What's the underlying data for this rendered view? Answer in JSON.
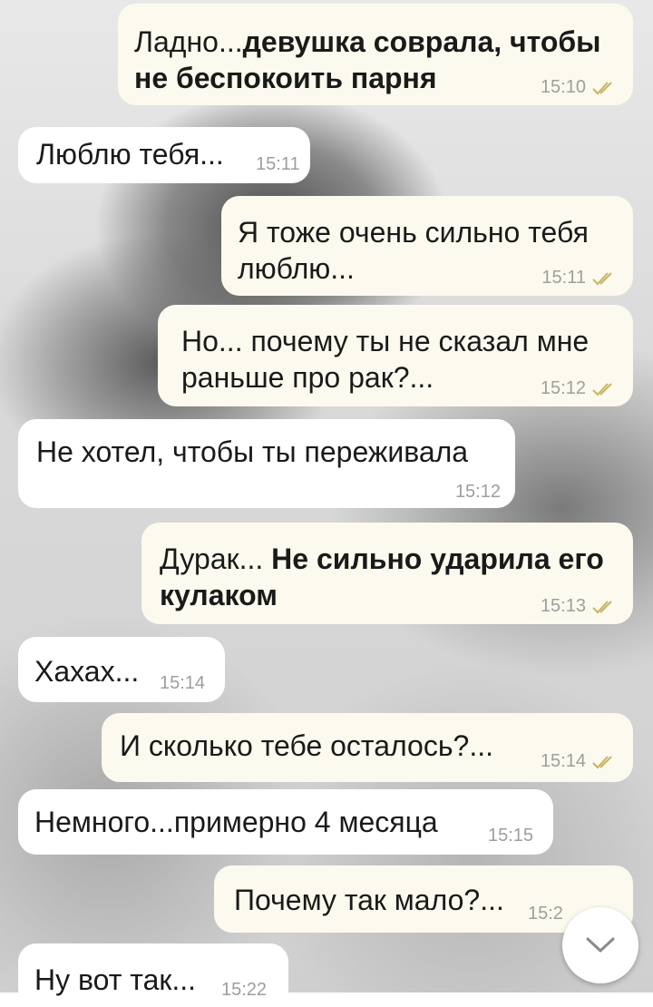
{
  "colors": {
    "outgoing_bubble": "#fcfaee",
    "incoming_bubble": "#ffffff",
    "tick_color": "#c9b463",
    "time_color": "#9e9e9e"
  },
  "messages": [
    {
      "dir": "out",
      "text_plain": "Ладно...",
      "text_bold": "девушка соврала, чтобы не беспокоить парня",
      "time": "15:10",
      "ticks": true
    },
    {
      "dir": "in",
      "text_plain": "Люблю тебя...",
      "time": "15:11"
    },
    {
      "dir": "out",
      "text_plain": "Я тоже очень сильно тебя люблю...",
      "time": "15:11",
      "ticks": true
    },
    {
      "dir": "out",
      "text_plain": "Но... почему ты не сказал мне раньше про рак?...",
      "time": "15:12",
      "ticks": true
    },
    {
      "dir": "in",
      "text_plain": "Не хотел, чтобы ты переживала",
      "time": "15:12"
    },
    {
      "dir": "out",
      "text_plain": "Дурак... ",
      "text_bold": "Не сильно ударила его кулаком",
      "time": "15:13",
      "ticks": true
    },
    {
      "dir": "in",
      "text_plain": "Хахах...",
      "time": "15:14"
    },
    {
      "dir": "out",
      "text_plain": "И сколько тебе осталось?...",
      "time": "15:14",
      "ticks": true
    },
    {
      "dir": "in",
      "text_plain": "Немного...примерно 4 месяца",
      "time": "15:15"
    },
    {
      "dir": "out",
      "text_plain": "Почему так мало?...",
      "time": "15:2",
      "ticks": true
    },
    {
      "dir": "in",
      "text_plain": "Ну вот так...",
      "time": "15:22"
    }
  ],
  "scroll_button": {
    "icon": "chevron-down-icon"
  }
}
